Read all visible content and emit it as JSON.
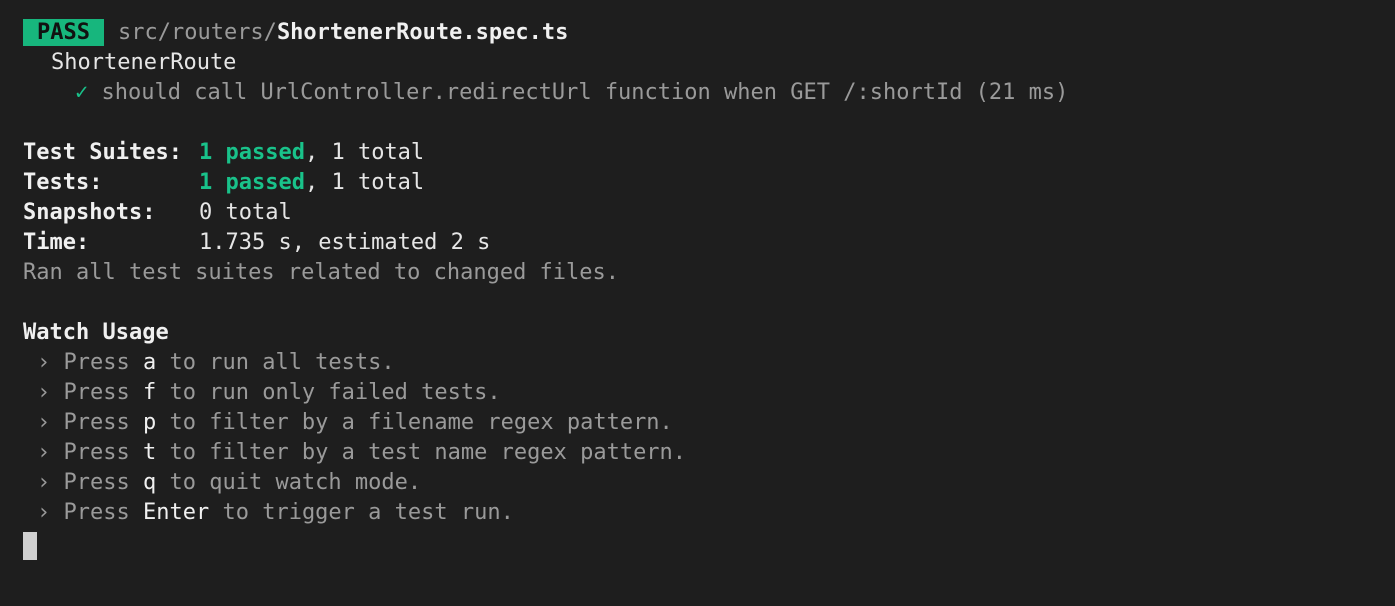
{
  "header": {
    "badge": "PASS",
    "path_dir": "src/routers/",
    "path_file": "ShortenerRoute.spec.ts"
  },
  "suite": {
    "name": "ShortenerRoute",
    "test": {
      "check": "✓",
      "description": "should call UrlController.redirectUrl function when GET /:shortId (21 ms)"
    }
  },
  "summary": {
    "suites": {
      "label": "Test Suites:",
      "passed": "1 passed",
      "rest": ", 1 total"
    },
    "tests": {
      "label": "Tests:",
      "passed": "1 passed",
      "rest": ", 1 total"
    },
    "snapshots": {
      "label": "Snapshots:",
      "value": "0 total"
    },
    "time": {
      "label": "Time:",
      "value": "1.735 s, estimated 2 s"
    },
    "note": "Ran all test suites related to changed files."
  },
  "watch": {
    "title": "Watch Usage",
    "chevron": "›",
    "press": "Press",
    "items": [
      {
        "key": "a",
        "text": "to run all tests."
      },
      {
        "key": "f",
        "text": "to run only failed tests."
      },
      {
        "key": "p",
        "text": "to filter by a filename regex pattern."
      },
      {
        "key": "t",
        "text": "to filter by a test name regex pattern."
      },
      {
        "key": "q",
        "text": "to quit watch mode."
      },
      {
        "key": "Enter",
        "text": "to trigger a test run."
      }
    ]
  },
  "colors": {
    "background": "#1e1e1e",
    "pass_badge": "#17b67d",
    "passed_text": "#19c28a",
    "dim_text": "#9a9a9a"
  }
}
